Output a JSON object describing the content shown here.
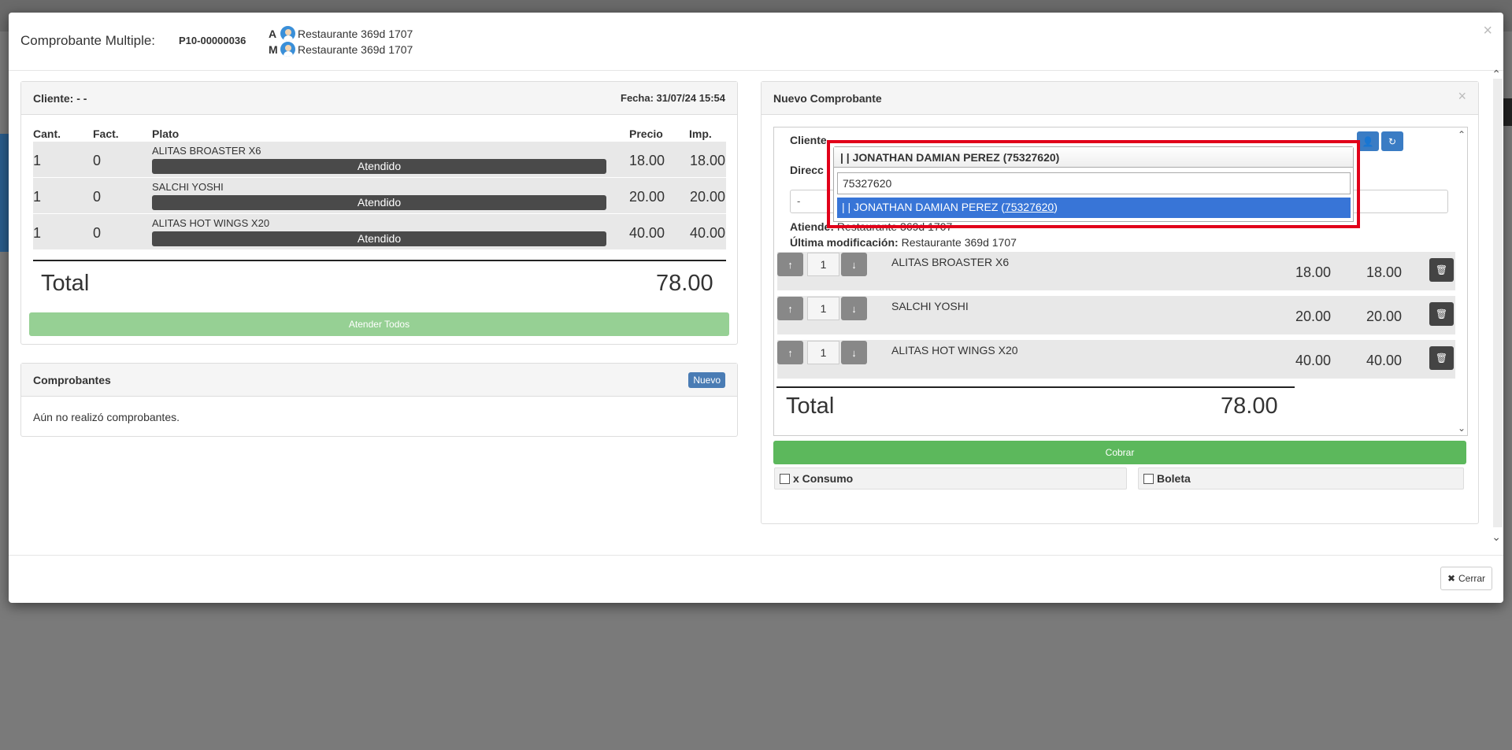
{
  "modal": {
    "title": "Comprobante Multiple:",
    "code": "P10-00000036",
    "users": [
      {
        "tag": "A",
        "name": "Restaurante 369d 1707"
      },
      {
        "tag": "M",
        "name": "Restaurante 369d 1707"
      }
    ],
    "close_icon": "×",
    "footer_close_label": "Cerrar"
  },
  "order_panel": {
    "client_label": "Cliente: - -",
    "date_label": "Fecha: 31/07/24 15:54",
    "columns": [
      "Cant.",
      "Fact.",
      "Plato",
      "Precio",
      "Imp."
    ],
    "rows": [
      {
        "qty": "1",
        "fact": "0",
        "dish": "ALITAS BROASTER X6",
        "status": "Atendido",
        "price": "18.00",
        "amount": "18.00"
      },
      {
        "qty": "1",
        "fact": "0",
        "dish": "SALCHI YOSHI",
        "status": "Atendido",
        "price": "20.00",
        "amount": "20.00"
      },
      {
        "qty": "1",
        "fact": "0",
        "dish": "ALITAS HOT WINGS X20",
        "status": "Atendido",
        "price": "40.00",
        "amount": "40.00"
      }
    ],
    "total_label": "Total",
    "total_value": "78.00",
    "attend_all_label": "Atender Todos"
  },
  "receipts_panel": {
    "title": "Comprobantes",
    "new_label": "Nuevo",
    "empty_text": "Aún no realizó comprobantes."
  },
  "new_receipt": {
    "title": "Nuevo Comprobante",
    "close_icon": "×",
    "client_label": "Cliente",
    "address_label": "Direcc",
    "address_value": "-",
    "attends_label": "Atiende:",
    "attends_value": "Restaurante 369d 1707",
    "modified_label": "Última modificación:",
    "modified_value": "Restaurante 369d 1707",
    "items": [
      {
        "qty": "1",
        "name": "ALITAS BROASTER X6",
        "price": "18.00",
        "amount": "18.00"
      },
      {
        "qty": "1",
        "name": "SALCHI YOSHI",
        "price": "20.00",
        "amount": "20.00"
      },
      {
        "qty": "1",
        "name": "ALITAS HOT WINGS X20",
        "price": "40.00",
        "amount": "40.00"
      }
    ],
    "total_label": "Total",
    "total_value": "78.00",
    "charge_label": "Cobrar",
    "consumo_label": "x Consumo",
    "boleta_label": "Boleta"
  },
  "client_select": {
    "selected": "| | JONATHAN DAMIAN PEREZ (75327620)",
    "search_value": "75327620",
    "option_prefix": "| | JONATHAN DAMIAN PEREZ (",
    "option_match": "75327620",
    "option_suffix": ")"
  },
  "colors": {
    "highlight_frame": "#e1001a",
    "selected_option": "#3875d7",
    "cobrar": "#5cb85c",
    "atender_todos": "#96d094",
    "nuevo_badge": "#4a7cb4"
  }
}
